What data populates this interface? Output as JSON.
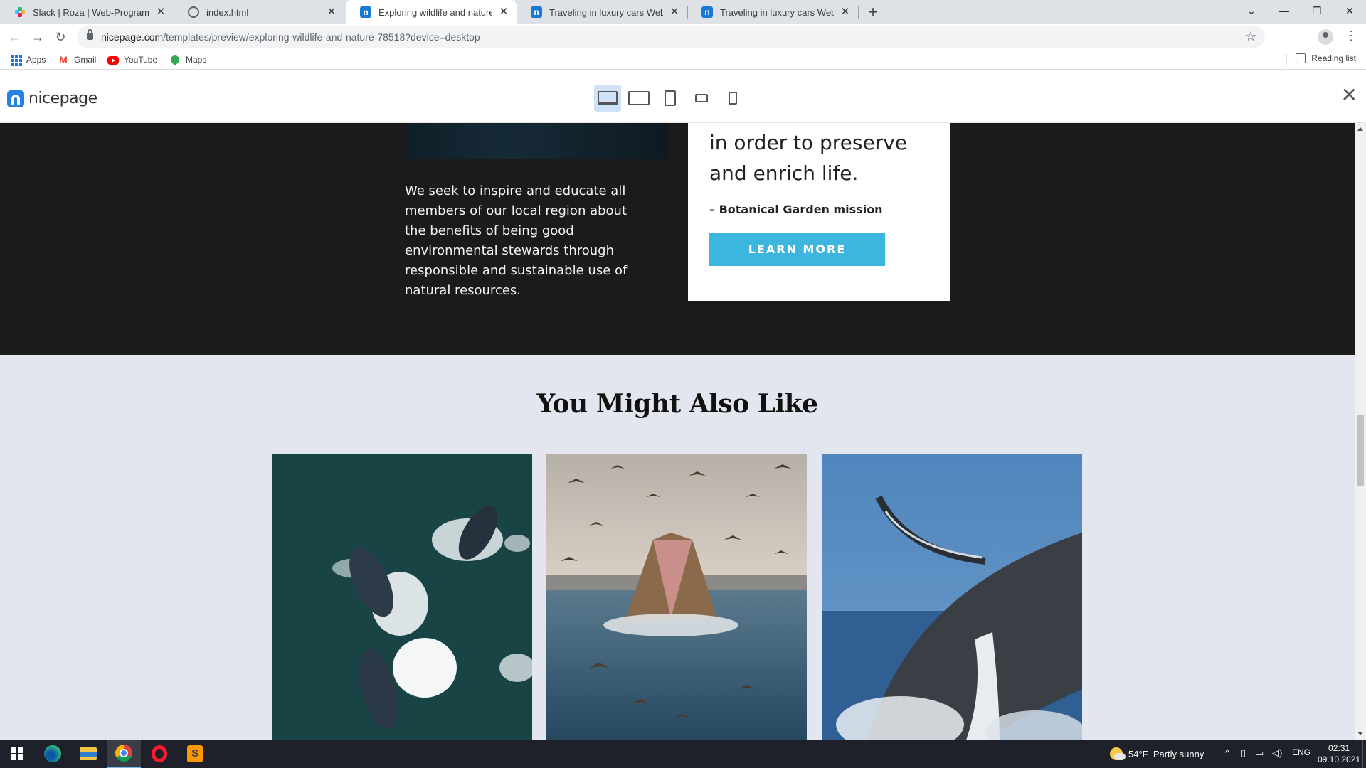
{
  "browser": {
    "tabs": [
      {
        "title": "Slack | Roza | Web-Programming",
        "icon": "slack-icon",
        "active": false
      },
      {
        "title": "index.html",
        "icon": "globe-icon",
        "active": false
      },
      {
        "title": "Exploring wildlife and nature Tem",
        "icon": "nicepage-icon",
        "active": true
      },
      {
        "title": "Traveling in luxury cars Web Page",
        "icon": "nicepage-icon",
        "active": false
      },
      {
        "title": "Traveling in luxury cars Web Page",
        "icon": "nicepage-icon",
        "active": false
      }
    ],
    "new_tab": "+",
    "url_host": "nicepage.com",
    "url_path": "/templates/preview/exploring-wildlife-and-nature-78518?device=desktop",
    "bookmarks": [
      {
        "label": "Apps",
        "icon": "apps-icon"
      },
      {
        "label": "Gmail",
        "icon": "gmail-icon"
      },
      {
        "label": "YouTube",
        "icon": "youtube-icon"
      },
      {
        "label": "Maps",
        "icon": "maps-icon"
      }
    ],
    "reading_list": "Reading list"
  },
  "preview": {
    "logo_text": "nicepage",
    "devices": [
      "desktop",
      "laptop",
      "tablet",
      "phone-landscape",
      "phone-portrait"
    ],
    "selected_device": "desktop"
  },
  "page": {
    "mission_text": "We seek to inspire and educate all members of our local region about the benefits of being good environmental stewards through responsible and sustainable use of natural resources.",
    "quote": "in order to preserve and enrich life.",
    "attribution": "– Botanical Garden mission",
    "learn_more": "LEARN MORE",
    "also_like_title": "You Might Also Like",
    "cards": [
      {
        "subject": "humpback whales from above"
      },
      {
        "subject": "whale feeding among birds"
      },
      {
        "subject": "breaching humpback whale"
      }
    ],
    "colors": {
      "dark_bg": "#1b1b1b",
      "light_bg": "#e3e6ee",
      "button": "#3cb6de"
    }
  },
  "taskbar": {
    "weather": "54°F  Partly sunny",
    "language": "ENG",
    "time": "02:31",
    "date": "09.10.2021"
  }
}
